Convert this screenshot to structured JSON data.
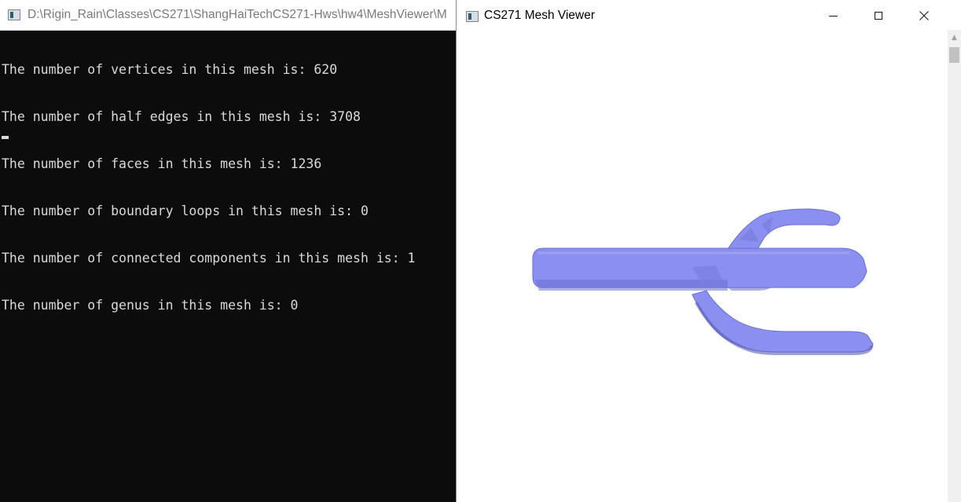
{
  "console": {
    "title": "D:\\Rigin_Rain\\Classes\\CS271\\ShangHaiTechCS271-Hws\\hw4\\MeshViewer\\M",
    "lines": [
      "The number of vertices in this mesh is: 620",
      "The number of half edges in this mesh is: 3708",
      "The number of faces in this mesh is: 1236",
      "The number of boundary loops in this mesh is: 0",
      "The number of connected components in this mesh is: 1",
      "The number of genus in this mesh is: 0"
    ]
  },
  "viewer": {
    "title": "CS271 Mesh Viewer",
    "mesh_color": "#8b8ff0",
    "mesh_shadow_color": "#5a5fb8"
  },
  "icons": {
    "app_icon": "console-app-icon",
    "minimize": "minimize-icon",
    "maximize": "maximize-icon",
    "close": "close-icon"
  }
}
